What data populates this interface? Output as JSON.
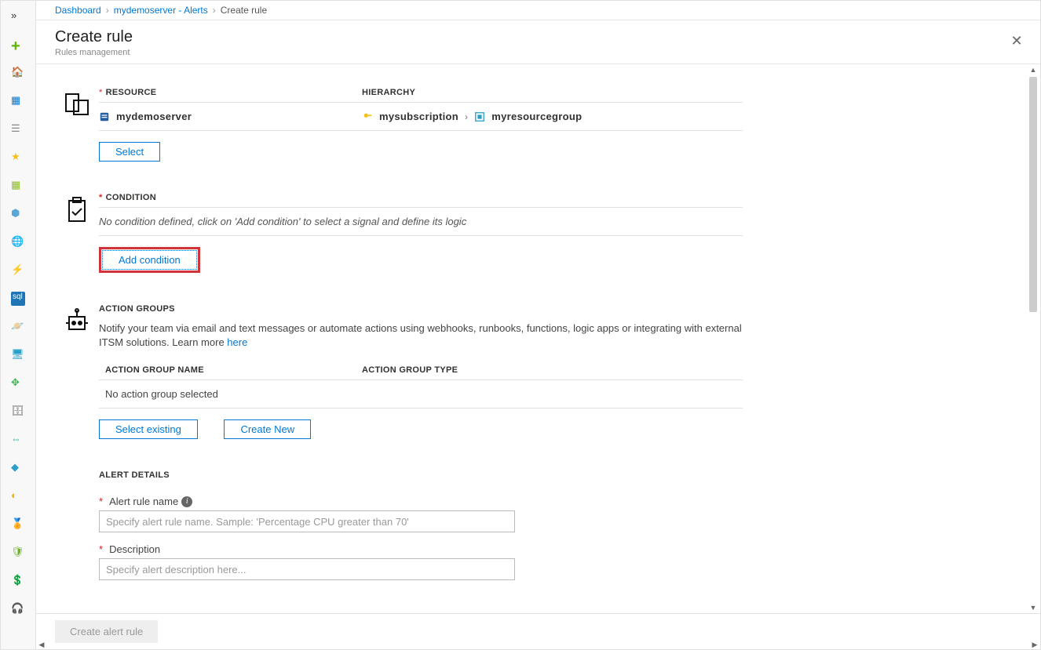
{
  "breadcrumb": {
    "dashboard": "Dashboard",
    "parent": "mydemoserver - Alerts",
    "current": "Create rule"
  },
  "blade": {
    "title": "Create rule",
    "subtitle": "Rules management"
  },
  "resource": {
    "header": "RESOURCE",
    "hierarchy_header": "HIERARCHY",
    "name": "mydemoserver",
    "subscription": "mysubscription",
    "resource_group": "myresourcegroup",
    "select_btn": "Select"
  },
  "condition": {
    "header": "CONDITION",
    "helper": "No condition defined, click on 'Add condition' to select a signal and define its logic",
    "add_btn": "Add condition"
  },
  "action_groups": {
    "header": "ACTION GROUPS",
    "description": "Notify your team via email and text messages or automate actions using webhooks, runbooks, functions, logic apps or integrating with external ITSM solutions. Learn more ",
    "learn_more": "here",
    "col_name": "ACTION GROUP NAME",
    "col_type": "ACTION GROUP TYPE",
    "empty": "No action group selected",
    "select_existing_btn": "Select existing",
    "create_new_btn": "Create New"
  },
  "alert_details": {
    "header": "ALERT DETAILS",
    "name_label": "Alert rule name",
    "name_placeholder": "Specify alert rule name. Sample: 'Percentage CPU greater than 70'",
    "desc_label": "Description",
    "desc_placeholder": "Specify alert description here..."
  },
  "footer": {
    "create_btn": "Create alert rule"
  },
  "colors": {
    "link": "#0078d4",
    "required": "#d22",
    "highlight": "#d13438"
  }
}
